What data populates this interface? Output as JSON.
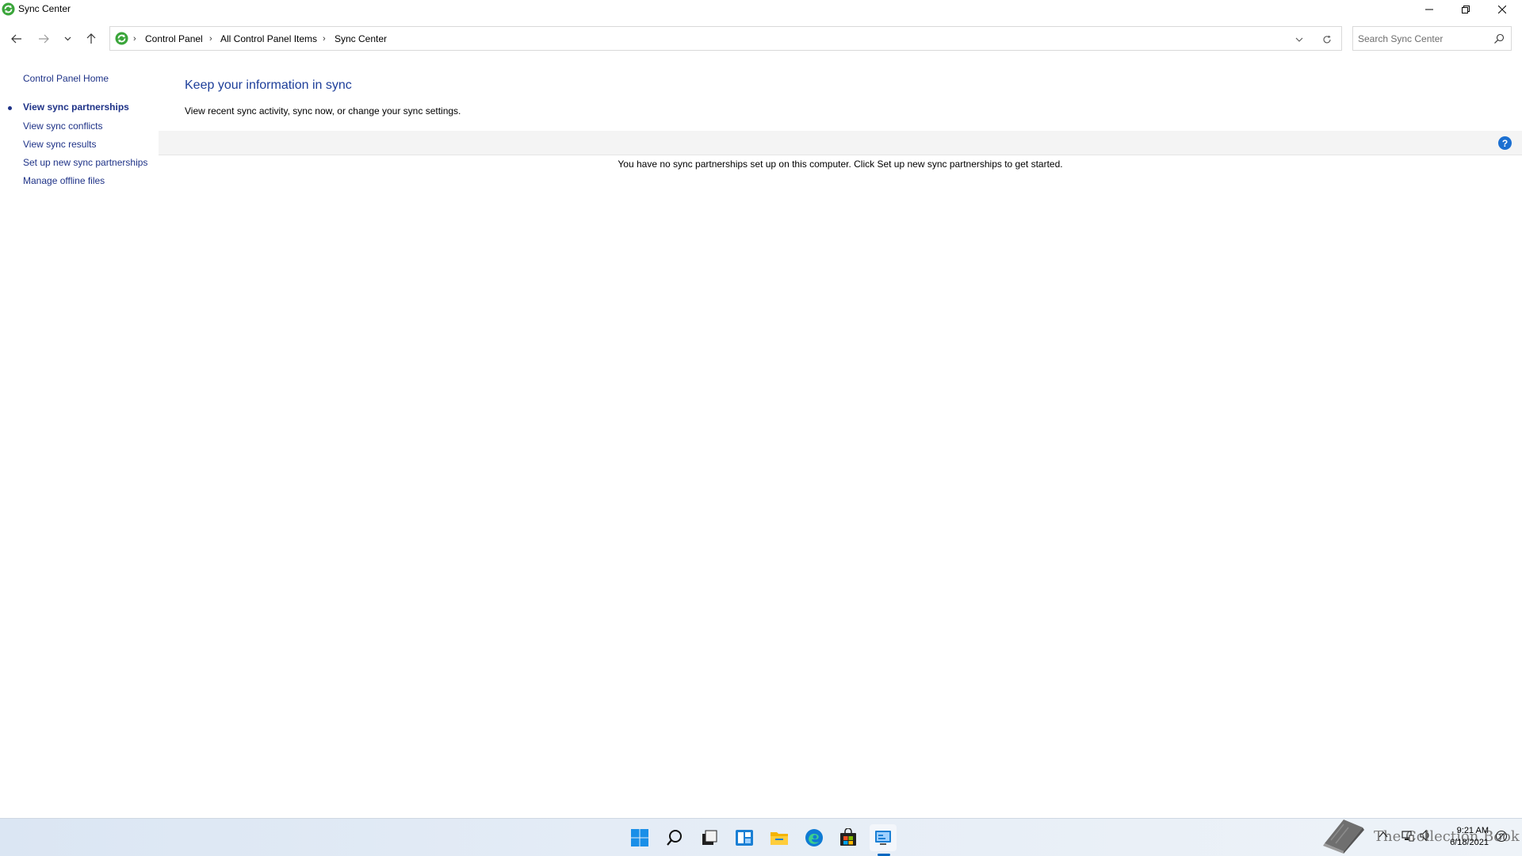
{
  "window": {
    "title": "Sync Center",
    "icon": "sync-center-icon",
    "controls": [
      "minimize-icon",
      "restore-icon",
      "close-icon"
    ]
  },
  "nav": {
    "breadcrumb": [
      "Control Panel",
      "All Control Panel Items",
      "Sync Center"
    ],
    "search_placeholder": "Search Sync Center"
  },
  "sidebar": {
    "home": "Control Panel Home",
    "items": [
      {
        "label": "View sync partnerships",
        "active": true
      },
      {
        "label": "View sync conflicts",
        "active": false
      },
      {
        "label": "View sync results",
        "active": false
      },
      {
        "label": "Set up new sync partnerships",
        "active": false
      },
      {
        "label": "Manage offline files",
        "active": false
      }
    ]
  },
  "main": {
    "heading": "Keep your information in sync",
    "subtitle": "View recent sync activity, sync now, or change your sync settings.",
    "help": "?",
    "empty_message": "You have no sync partnerships set up on this computer. Click Set up new sync partnerships to get started."
  },
  "taskbar": {
    "apps": [
      "start-icon",
      "search-icon",
      "task-view-icon",
      "widgets-icon",
      "file-explorer-icon",
      "edge-icon",
      "store-icon",
      "control-panel-icon"
    ],
    "watermark": "The Collection Book",
    "clock_time": "9:21 AM",
    "clock_date": "6/18/2021"
  },
  "colors": {
    "link": "#1e3287",
    "heading": "#1e3f9a",
    "accent": "#0067c0",
    "help": "#1b6fd1"
  }
}
